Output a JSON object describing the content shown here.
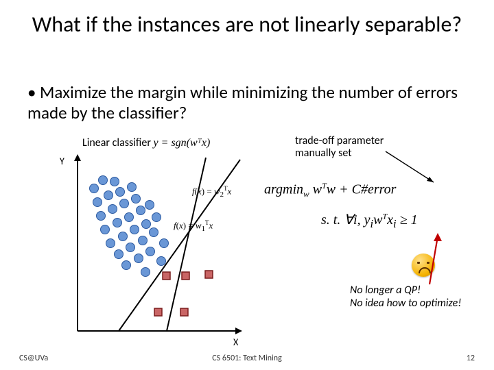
{
  "title": "What if the instances are not linearly separable?",
  "bullet": "Maximize the margin while minimizing the number of errors made by the classifier?",
  "classifier_label": "Linear classifier ",
  "classifier_formula": "y = sgn(wᵀx)",
  "tradeoff_note_l1": "trade-off parameter",
  "tradeoff_note_l2": "manually set",
  "axis_y": "Y",
  "axis_x": "X",
  "fx_w2": "f(x) = w₂ᵀx",
  "fx_w1": "f(x) = w₁ᵀx",
  "opt_line1": "argmin_w wᵀw + C#error",
  "opt_line2": "s.t. ∀i, yᵢwᵀxᵢ ≥ 1",
  "no_longer_l1": "No longer a QP!",
  "no_longer_l2": "No idea how to optimize!",
  "footer_left": "CS@UVa",
  "footer_center": "CS 6501: Text Mining",
  "footer_right": "12",
  "chart_data": {
    "type": "scatter",
    "title": "",
    "xlabel": "X",
    "ylabel": "Y",
    "xlim": [
      0,
      10
    ],
    "ylim": [
      0,
      10
    ],
    "series": [
      {
        "name": "class-blue",
        "color": "#5b8bd0",
        "points": [
          [
            1.1,
            8.2
          ],
          [
            1.6,
            8.7
          ],
          [
            2.3,
            8.6
          ],
          [
            1.3,
            7.4
          ],
          [
            2.0,
            7.8
          ],
          [
            2.7,
            8.0
          ],
          [
            3.4,
            8.3
          ],
          [
            1.5,
            6.6
          ],
          [
            2.2,
            7.0
          ],
          [
            2.9,
            7.3
          ],
          [
            3.6,
            7.6
          ],
          [
            1.8,
            5.8
          ],
          [
            2.5,
            6.2
          ],
          [
            3.2,
            6.5
          ],
          [
            3.9,
            6.9
          ],
          [
            4.4,
            7.2
          ],
          [
            2.1,
            5.0
          ],
          [
            2.8,
            5.4
          ],
          [
            3.5,
            5.8
          ],
          [
            4.2,
            6.1
          ],
          [
            4.8,
            6.5
          ],
          [
            2.6,
            4.4
          ],
          [
            3.3,
            4.8
          ],
          [
            4.0,
            5.2
          ],
          [
            4.7,
            5.6
          ],
          [
            5.3,
            5.0
          ],
          [
            3.1,
            3.8
          ],
          [
            3.8,
            4.2
          ],
          [
            4.5,
            4.6
          ],
          [
            5.1,
            4.0
          ],
          [
            4.2,
            3.4
          ]
        ]
      },
      {
        "name": "class-red",
        "color": "#c34a4a",
        "points": [
          [
            5.4,
            3.1
          ],
          [
            6.6,
            3.1
          ],
          [
            8.0,
            3.2
          ],
          [
            4.9,
            1.1
          ],
          [
            6.4,
            1.1
          ]
        ]
      }
    ],
    "lines": [
      {
        "name": "w1",
        "x": [
          5.4,
          7.6
        ],
        "y": [
          0,
          10
        ]
      },
      {
        "name": "w2",
        "x": [
          2.6,
          9.7
        ],
        "y": [
          0,
          10
        ]
      }
    ]
  }
}
